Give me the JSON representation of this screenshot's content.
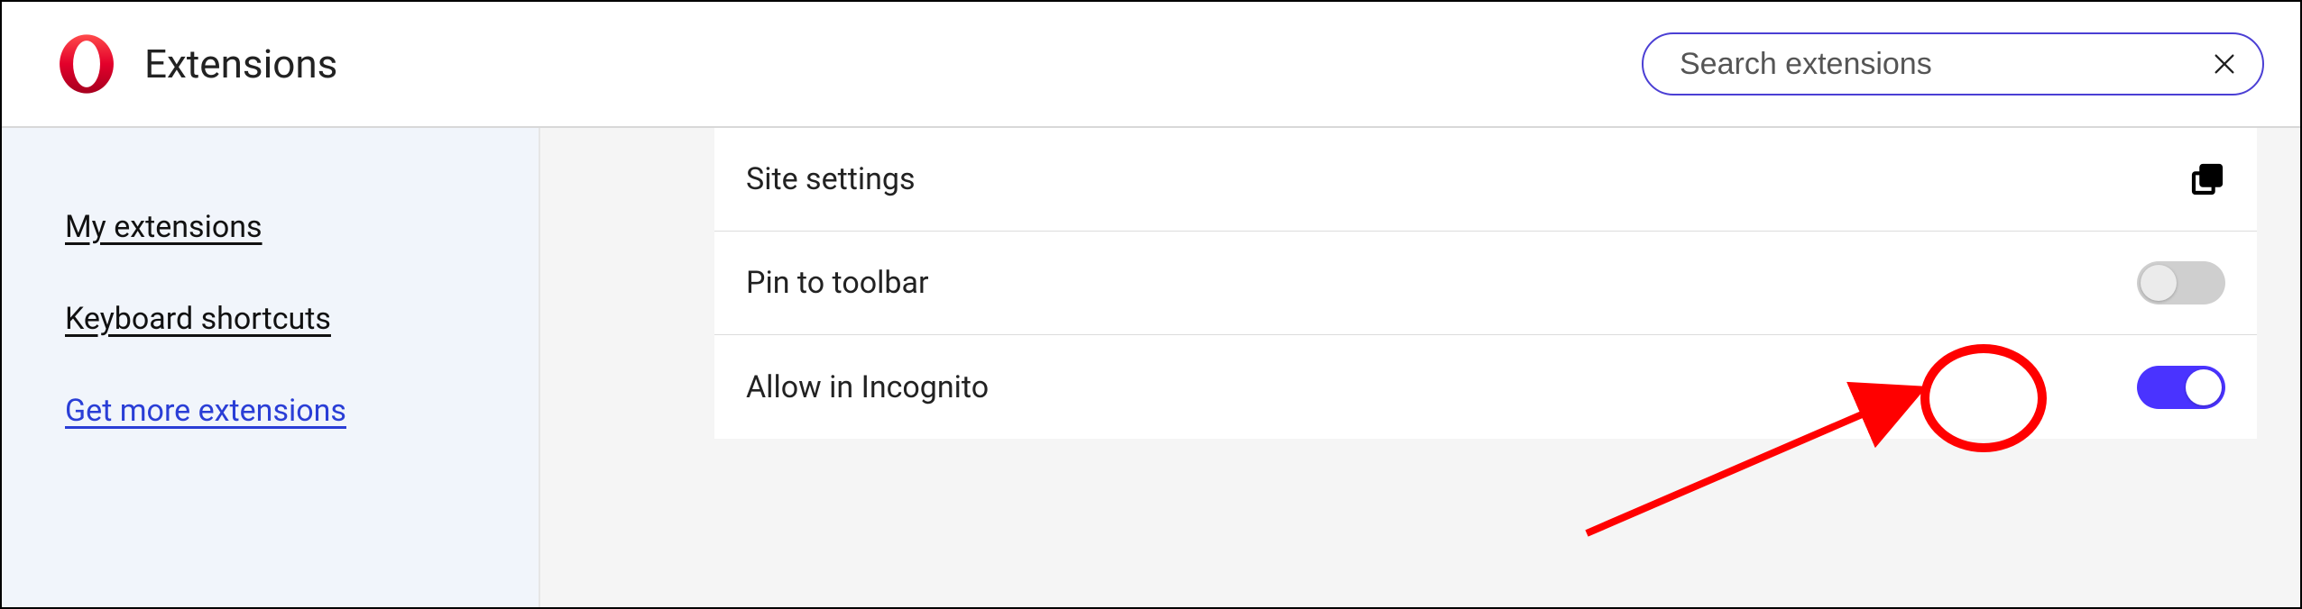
{
  "header": {
    "title": "Extensions",
    "search_placeholder": "Search extensions"
  },
  "sidebar": {
    "items": [
      {
        "label": "My extensions"
      },
      {
        "label": "Keyboard shortcuts"
      },
      {
        "label": "Get more extensions",
        "accent": true
      }
    ]
  },
  "settings": {
    "rows": [
      {
        "label": "Site settings",
        "type": "link"
      },
      {
        "label": "Pin to toolbar",
        "type": "toggle",
        "on": false
      },
      {
        "label": "Allow in Incognito",
        "type": "toggle",
        "on": true
      }
    ]
  },
  "annotation": {
    "highlight_color": "#ff0000"
  }
}
